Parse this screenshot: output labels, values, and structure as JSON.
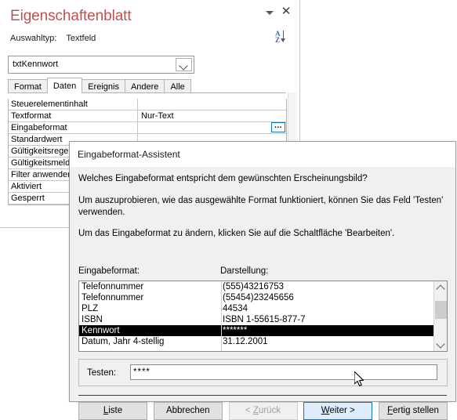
{
  "property_sheet": {
    "title": "Eigenschaftenblatt",
    "selection_label": "Auswahltyp:",
    "selection_value": "Textfeld",
    "collapse_icon": "caret-down-icon",
    "close_icon": "close-icon",
    "sort_icon": "sort-az-icon",
    "sort_letters": {
      "a": "A",
      "z": "Z"
    },
    "combo_value": "txtKennwort",
    "combo_arrow_icon": "chevron-down-icon",
    "tabs": [
      {
        "label": "Format",
        "active": false
      },
      {
        "label": "Daten",
        "active": true
      },
      {
        "label": "Ereignis",
        "active": false
      },
      {
        "label": "Andere",
        "active": false
      },
      {
        "label": "Alle",
        "active": false
      }
    ],
    "rows": [
      {
        "name": "Steuerelementinhalt",
        "value": "",
        "builder": false
      },
      {
        "name": "Textformat",
        "value": "Nur-Text",
        "builder": false
      },
      {
        "name": "Eingabeformat",
        "value": "",
        "builder": true,
        "builder_label": "..."
      },
      {
        "name": "Standardwert",
        "value": "",
        "builder": false
      },
      {
        "name": "Gültigkeitsregel",
        "value": "",
        "builder": false
      },
      {
        "name": "Gültigkeitsmeldung",
        "value": "",
        "builder": false
      },
      {
        "name": "Filter anwenden",
        "value": "",
        "builder": false
      },
      {
        "name": "Aktiviert",
        "value": "",
        "builder": false
      },
      {
        "name": "Gesperrt",
        "value": "",
        "builder": false
      }
    ]
  },
  "wizard": {
    "title": "Eingabeformat-Assistent",
    "paragraph1": "Welches Eingabeformat entspricht dem gewünschten Erscheinungsbild?",
    "paragraph2": "Um auszuprobieren, wie das ausgewählte Format funktioniert, können Sie das Feld 'Testen' verwenden.",
    "paragraph3": "Um das Eingabeformat zu ändern, klicken Sie auf die Schaltfläche 'Bearbeiten'.",
    "column_headers": {
      "format": "Eingabeformat:",
      "display": "Darstellung:"
    },
    "list_items": [
      {
        "format": "Telefonnummer",
        "display": "(555)43216753",
        "selected": false
      },
      {
        "format": "Telefonnummer",
        "display": "(55454)23245656",
        "selected": false
      },
      {
        "format": "PLZ",
        "display": "44534",
        "selected": false
      },
      {
        "format": "ISBN",
        "display": "ISBN 1-55615-877-7",
        "selected": false
      },
      {
        "format": "Kennwort",
        "display": "*******",
        "selected": true
      },
      {
        "format": "Datum, Jahr 4-stellig",
        "display": "31.12.2001",
        "selected": false
      }
    ],
    "scroll_up_icon": "chevron-up-icon",
    "scroll_down_icon": "chevron-down-icon",
    "test": {
      "label": "Testen:",
      "value": "****"
    },
    "buttons": [
      {
        "label": "Liste",
        "accel": "L",
        "state": "normal"
      },
      {
        "label": "Abbrechen",
        "accel": "",
        "state": "normal"
      },
      {
        "label": "< Zurück",
        "accel": "Z",
        "state": "disabled"
      },
      {
        "label": "Weiter >",
        "accel": "W",
        "state": "default"
      },
      {
        "label": "Fertig stellen",
        "accel": "F",
        "state": "normal"
      }
    ]
  },
  "colors": {
    "title_red": "#b85450",
    "accent_blue": "#0f76c4",
    "selection_black": "#000000",
    "dialog_bg": "#f0f0f0"
  }
}
